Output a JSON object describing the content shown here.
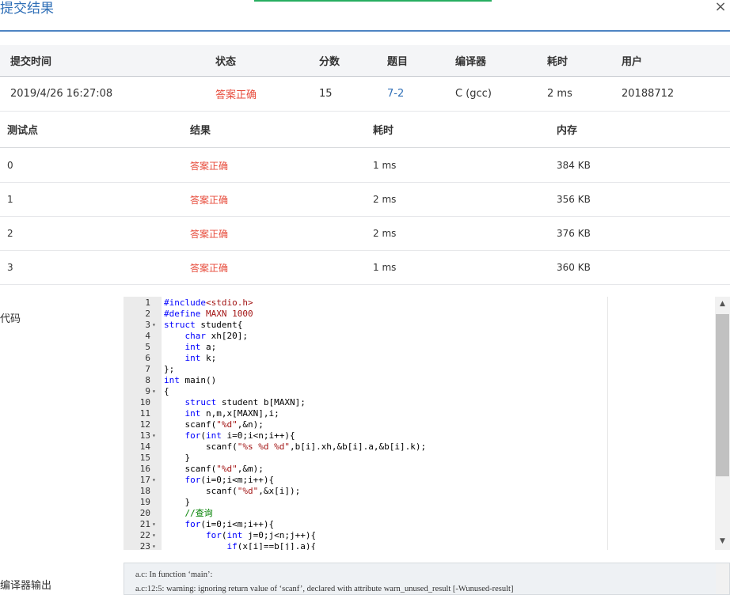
{
  "dialog": {
    "title": "提交结果",
    "close_symbol": "×"
  },
  "summary": {
    "headers": [
      "提交时间",
      "状态",
      "分数",
      "题目",
      "编译器",
      "耗时",
      "用户"
    ],
    "row": {
      "time": "2019/4/26 16:27:08",
      "status": "答案正确",
      "score": "15",
      "problem": "7-2",
      "compiler": "C (gcc)",
      "duration": "2 ms",
      "user": "20188712"
    }
  },
  "tests": {
    "headers": [
      "测试点",
      "结果",
      "耗时",
      "内存"
    ],
    "rows": [
      {
        "id": "0",
        "result": "答案正确",
        "time": "1 ms",
        "memory": "384 KB"
      },
      {
        "id": "1",
        "result": "答案正确",
        "time": "2 ms",
        "memory": "356 KB"
      },
      {
        "id": "2",
        "result": "答案正确",
        "time": "2 ms",
        "memory": "376 KB"
      },
      {
        "id": "3",
        "result": "答案正确",
        "time": "1 ms",
        "memory": "360 KB"
      }
    ]
  },
  "code": {
    "label": "代码",
    "lines": [
      {
        "n": "1",
        "fold": false,
        "text": "#include<stdio.h>"
      },
      {
        "n": "2",
        "fold": false,
        "text": "#define MAXN 1000"
      },
      {
        "n": "3",
        "fold": true,
        "text": "struct student{"
      },
      {
        "n": "4",
        "fold": false,
        "text": "    char xh[20];"
      },
      {
        "n": "5",
        "fold": false,
        "text": "    int a;"
      },
      {
        "n": "6",
        "fold": false,
        "text": "    int k;"
      },
      {
        "n": "7",
        "fold": false,
        "text": "};"
      },
      {
        "n": "8",
        "fold": false,
        "text": "int main()"
      },
      {
        "n": "9",
        "fold": true,
        "text": "{"
      },
      {
        "n": "10",
        "fold": false,
        "text": "    struct student b[MAXN];"
      },
      {
        "n": "11",
        "fold": false,
        "text": "    int n,m,x[MAXN],i;"
      },
      {
        "n": "12",
        "fold": false,
        "text": "    scanf(\"%d\",&n);"
      },
      {
        "n": "13",
        "fold": true,
        "text": "    for(int i=0;i<n;i++){"
      },
      {
        "n": "14",
        "fold": false,
        "text": "        scanf(\"%s %d %d\",b[i].xh,&b[i].a,&b[i].k);"
      },
      {
        "n": "15",
        "fold": false,
        "text": "    }"
      },
      {
        "n": "16",
        "fold": false,
        "text": "    scanf(\"%d\",&m);"
      },
      {
        "n": "17",
        "fold": true,
        "text": "    for(i=0;i<m;i++){"
      },
      {
        "n": "18",
        "fold": false,
        "text": "        scanf(\"%d\",&x[i]);"
      },
      {
        "n": "19",
        "fold": false,
        "text": "    }"
      },
      {
        "n": "20",
        "fold": false,
        "text": "    //查询"
      },
      {
        "n": "21",
        "fold": true,
        "text": "    for(i=0;i<m;i++){"
      },
      {
        "n": "22",
        "fold": true,
        "text": "        for(int j=0;j<n;j++){"
      },
      {
        "n": "23",
        "fold": true,
        "text": "            if(x[i]==b[j].a){"
      }
    ]
  },
  "compiler_output": {
    "label": "编译器输出",
    "lines": [
      "a.c: In function ‘main’:",
      "a.c:12:5: warning: ignoring return value of ‘scanf’, declared with attribute warn_unused_result [-Wunused-result]"
    ]
  },
  "colors": {
    "accent": "#2f6fb7",
    "accepted": "#e74c3c",
    "top_bar": "#27ae60"
  }
}
